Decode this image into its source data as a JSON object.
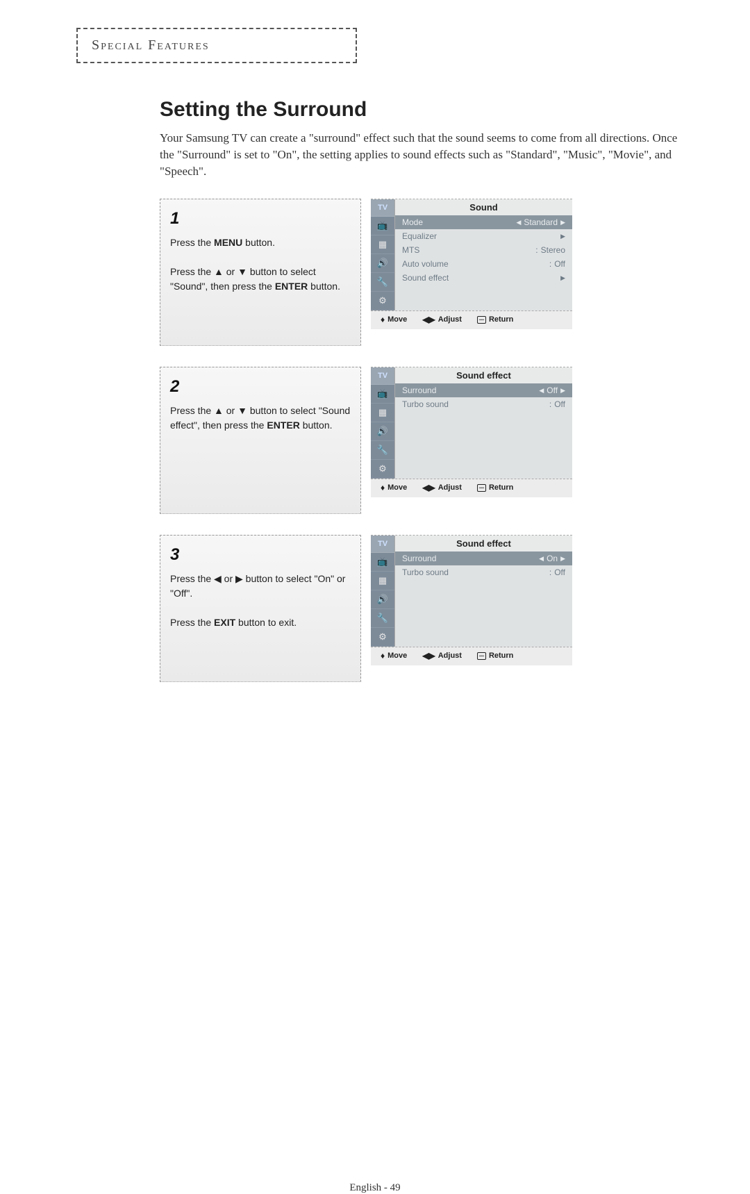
{
  "header_box": "Special Features",
  "title": "Setting the Surround",
  "intro": "Your Samsung TV can create a \"surround\" effect such that the sound seems to come from all directions. Once the \"Surround\" is set to \"On\", the setting applies to sound effects such as \"Standard\", \"Music\", \"Movie\", and \"Speech\".",
  "steps": [
    {
      "num": "1",
      "text_parts": [
        "Press the ",
        "MENU",
        " button."
      ],
      "text2_parts": [
        "Press the ▲ or ▼ button to select \"Sound\", then press the ",
        "ENTER",
        " button."
      ]
    },
    {
      "num": "2",
      "text_parts": [
        "Press the ▲ or ▼ button to select \"Sound effect\", then press the ",
        "ENTER",
        " button."
      ]
    },
    {
      "num": "3",
      "text_parts": [
        "Press the ◀ or ▶ button to select \"On\" or \"Off\"."
      ],
      "text2_parts": [
        "Press the ",
        "EXIT",
        " button to exit."
      ]
    }
  ],
  "osd": [
    {
      "title": "Sound",
      "rows": [
        {
          "label": "Mode",
          "value": "Standard",
          "sel": true,
          "arrows": "lr"
        },
        {
          "label": "Equalizer",
          "value": "",
          "arrows": "r"
        },
        {
          "label": "MTS",
          "value": "Stereo",
          "arrows": ""
        },
        {
          "label": "Auto volume",
          "value": "Off",
          "arrows": ""
        },
        {
          "label": "Sound effect",
          "value": "",
          "arrows": "r"
        }
      ]
    },
    {
      "title": "Sound effect",
      "rows": [
        {
          "label": "Surround",
          "value": "Off",
          "sel": true,
          "arrows": "lr"
        },
        {
          "label": "Turbo sound",
          "value": "Off",
          "arrows": ""
        }
      ]
    },
    {
      "title": "Sound effect",
      "rows": [
        {
          "label": "Surround",
          "value": "On",
          "sel": true,
          "arrows": "lr"
        },
        {
          "label": "Turbo sound",
          "value": "Off",
          "arrows": ""
        }
      ]
    }
  ],
  "osd_footer": {
    "move": "Move",
    "adjust": "Adjust",
    "return": "Return"
  },
  "sidebar_tabs": [
    "TV",
    "📺",
    "▦",
    "🔊",
    "🔧",
    "⚙"
  ],
  "page_number": "English - 49"
}
